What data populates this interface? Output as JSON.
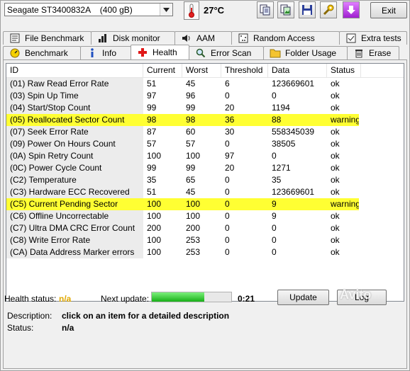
{
  "toolbar": {
    "drive": "Seagate ST3400832A    (400 gB)",
    "temperature": "27°C",
    "exit_label": "Exit"
  },
  "tabs_top": [
    {
      "label": "File Benchmark",
      "icon": "file-benchmark-icon"
    },
    {
      "label": "Disk monitor",
      "icon": "disk-monitor-icon"
    },
    {
      "label": "AAM",
      "icon": "speaker-icon"
    },
    {
      "label": "Random Access",
      "icon": "random-access-icon"
    },
    {
      "label": "Extra tests",
      "icon": "extra-tests-icon"
    }
  ],
  "tabs_bottom": [
    {
      "label": "Benchmark",
      "icon": "benchmark-icon"
    },
    {
      "label": "Info",
      "icon": "info-icon"
    },
    {
      "label": "Health",
      "icon": "health-cross-icon",
      "active": true
    },
    {
      "label": "Error Scan",
      "icon": "magnifier-icon"
    },
    {
      "label": "Folder Usage",
      "icon": "folder-icon"
    },
    {
      "label": "Erase",
      "icon": "trash-icon"
    }
  ],
  "table": {
    "headers": {
      "id": "ID",
      "current": "Current",
      "worst": "Worst",
      "threshold": "Threshold",
      "data": "Data",
      "status": "Status"
    },
    "rows": [
      {
        "id": "(01) Raw Read Error Rate",
        "current": "51",
        "worst": "45",
        "threshold": "6",
        "data": "123669601",
        "status": "ok"
      },
      {
        "id": "(03) Spin Up Time",
        "current": "97",
        "worst": "96",
        "threshold": "0",
        "data": "0",
        "status": "ok"
      },
      {
        "id": "(04) Start/Stop Count",
        "current": "99",
        "worst": "99",
        "threshold": "20",
        "data": "1194",
        "status": "ok"
      },
      {
        "id": "(05) Reallocated Sector Count",
        "current": "98",
        "worst": "98",
        "threshold": "36",
        "data": "88",
        "status": "warning",
        "warn": true
      },
      {
        "id": "(07) Seek Error Rate",
        "current": "87",
        "worst": "60",
        "threshold": "30",
        "data": "558345039",
        "status": "ok"
      },
      {
        "id": "(09) Power On Hours Count",
        "current": "57",
        "worst": "57",
        "threshold": "0",
        "data": "38505",
        "status": "ok"
      },
      {
        "id": "(0A) Spin Retry Count",
        "current": "100",
        "worst": "100",
        "threshold": "97",
        "data": "0",
        "status": "ok"
      },
      {
        "id": "(0C) Power Cycle Count",
        "current": "99",
        "worst": "99",
        "threshold": "20",
        "data": "1271",
        "status": "ok"
      },
      {
        "id": "(C2) Temperature",
        "current": "35",
        "worst": "65",
        "threshold": "0",
        "data": "35",
        "status": "ok"
      },
      {
        "id": "(C3) Hardware ECC Recovered",
        "current": "51",
        "worst": "45",
        "threshold": "0",
        "data": "123669601",
        "status": "ok"
      },
      {
        "id": "(C5) Current Pending Sector",
        "current": "100",
        "worst": "100",
        "threshold": "0",
        "data": "9",
        "status": "warning",
        "warn": true
      },
      {
        "id": "(C6) Offline Uncorrectable",
        "current": "100",
        "worst": "100",
        "threshold": "0",
        "data": "9",
        "status": "ok"
      },
      {
        "id": "(C7) Ultra DMA CRC Error Count",
        "current": "200",
        "worst": "200",
        "threshold": "0",
        "data": "0",
        "status": "ok"
      },
      {
        "id": "(C8) Write Error Rate",
        "current": "100",
        "worst": "253",
        "threshold": "0",
        "data": "0",
        "status": "ok"
      },
      {
        "id": "(CA) Data Address Marker errors",
        "current": "100",
        "worst": "253",
        "threshold": "0",
        "data": "0",
        "status": "ok"
      }
    ]
  },
  "details": {
    "description_label": "Description:",
    "description_value": "click on an item for a detailed description",
    "status_label": "Status:",
    "status_value": "n/a"
  },
  "footer": {
    "health_label": "Health status:",
    "health_value": "n/a",
    "next_update_label": "Next update:",
    "next_update_progress": 0.66,
    "countdown": "0:21",
    "update_label": "Update",
    "log_label": "Log",
    "watermark": "Avito"
  }
}
